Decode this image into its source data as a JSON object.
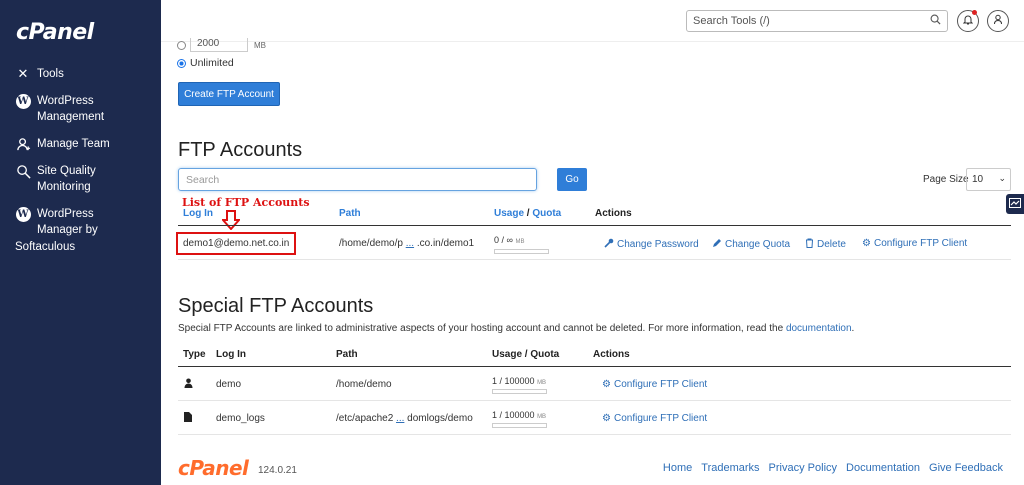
{
  "sidebar": {
    "logo": "cPanel",
    "items": [
      {
        "label": "Tools",
        "icon": "tools-icon"
      },
      {
        "label": "WordPress\nManagement",
        "icon": "wordpress-icon"
      },
      {
        "label": "Manage Team",
        "icon": "team-icon"
      },
      {
        "label": "Site Quality\nMonitoring",
        "icon": "magnifier-icon"
      },
      {
        "label": "WordPress\nManager by",
        "icon": "wordpress-icon"
      }
    ],
    "extra_label": "Softaculous"
  },
  "topbar": {
    "search_placeholder": "Search Tools (/)",
    "search_icon": "⌕",
    "notifications_icon": "bell-icon",
    "user_icon": "user-icon"
  },
  "create": {
    "quota_value": "2000",
    "quota_unit": "MB",
    "unlimited_label": "Unlimited",
    "button_label": "Create FTP Account"
  },
  "ftp_accounts": {
    "title": "FTP Accounts",
    "search_placeholder": "Search",
    "go_label": "Go",
    "page_size_label": "Page Size",
    "page_size_value": "10",
    "annotation": "List of FTP Accounts",
    "headers": {
      "login": "Log In",
      "path": "Path",
      "usage": "Usage",
      "slash": " / ",
      "quota": "Quota",
      "actions": "Actions"
    },
    "rows": [
      {
        "login": "demo1@demo.net.co.in",
        "path_start": "/home/demo/p",
        "path_ellipsis": "...",
        "path_end": ".co.in/demo1",
        "usage": "0 / ∞",
        "usage_unit": "MB",
        "actions": {
          "change_password": "Change Password",
          "change_quota": "Change Quota",
          "delete": "Delete",
          "configure": "Configure FTP Client"
        }
      }
    ]
  },
  "special": {
    "title": "Special FTP Accounts",
    "description": "Special FTP Accounts are linked to administrative aspects of your hosting account and cannot be deleted. For more information, read the",
    "doc_link": "documentation",
    "headers": {
      "type": "Type",
      "login": "Log In",
      "path": "Path",
      "usage_quota": "Usage / Quota",
      "actions": "Actions"
    },
    "rows": [
      {
        "type_icon": "user-icon",
        "login": "demo",
        "path": "/home/demo",
        "usage": "1 / 100000",
        "unit": "MB",
        "action": "Configure FTP Client"
      },
      {
        "type_icon": "file-icon",
        "login": "demo_logs",
        "path_start": "/etc/apache2",
        "path_ellipsis": "...",
        "path_end": "domlogs/demo",
        "usage": "1 / 100000",
        "unit": "MB",
        "action": "Configure FTP Client"
      }
    ]
  },
  "footer": {
    "logo": "cPanel",
    "version": "124.0.21",
    "links": [
      "Home",
      "Trademarks",
      "Privacy Policy",
      "Documentation",
      "Give Feedback"
    ]
  },
  "colors": {
    "sidebar": "#1d2a4e",
    "accent": "#2f7ed8",
    "annotation": "#dd1111",
    "brand_orange": "#ff6c2c"
  }
}
